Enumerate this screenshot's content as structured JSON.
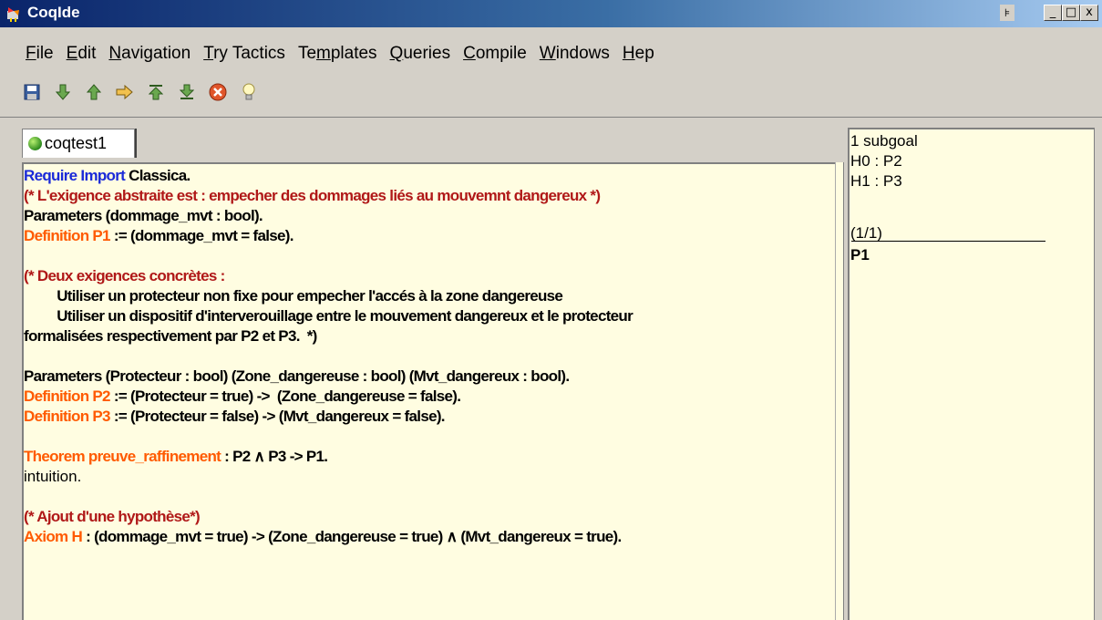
{
  "window": {
    "title": "CoqIde",
    "controls": {
      "pin": "⊧",
      "minimize": "_",
      "maximize": "□",
      "close": "x"
    }
  },
  "menu": [
    {
      "u": "F",
      "rest": "ile"
    },
    {
      "u": "E",
      "rest": "dit"
    },
    {
      "u": "N",
      "rest": "avigation"
    },
    {
      "u": "T",
      "rest": "ry Tactics"
    },
    {
      "pre": "Te",
      "u": "m",
      "rest": "plates"
    },
    {
      "u": "Q",
      "rest": "ueries"
    },
    {
      "u": "C",
      "rest": "ompile"
    },
    {
      "u": "W",
      "rest": "indows"
    },
    {
      "u": "H",
      "rest": "ep"
    }
  ],
  "toolbar": [
    "save-icon",
    "step-forward-icon",
    "step-back-icon",
    "go-to-cursor-icon",
    "go-to-start-icon",
    "go-to-end-icon",
    "interrupt-icon",
    "hint-icon"
  ],
  "tab": {
    "label": "coqtest1"
  },
  "code_lines": [
    [
      {
        "t": "Require Import ",
        "c": "kw-blue"
      },
      {
        "t": "Classica.",
        "c": ""
      }
    ],
    [
      {
        "t": "(* L'exigence abstraite est : empecher des dommages liés au mouvemnt dangereux *)",
        "c": "cmt"
      }
    ],
    [
      {
        "t": "Parameters (dommage_mvt : bool).",
        "c": ""
      }
    ],
    [
      {
        "t": "Definition P1",
        "c": "kw-orange"
      },
      {
        "t": " := (dommage_mvt = false).",
        "c": ""
      }
    ],
    [
      {
        "t": "",
        "c": ""
      }
    ],
    [
      {
        "t": "(* Deux exigences concrètes :",
        "c": "cmt"
      }
    ],
    [
      {
        "t": "         Utiliser un protecteur non fixe pour empecher l'accés à la zone dangereuse",
        "c": ""
      }
    ],
    [
      {
        "t": "         Utiliser un dispositif d'interverouillage entre le mouvement dangereux et le protecteur",
        "c": ""
      }
    ],
    [
      {
        "t": "formalisées respectivement par P2 et P3.  *)",
        "c": ""
      }
    ],
    [
      {
        "t": "",
        "c": ""
      }
    ],
    [
      {
        "t": "Parameters (Protecteur : bool) (Zone_dangereuse : bool) (Mvt_dangereux : bool).",
        "c": ""
      }
    ],
    [
      {
        "t": "Definition P2",
        "c": "kw-orange"
      },
      {
        "t": " := (Protecteur = true) ->  (Zone_dangereuse = false).",
        "c": ""
      }
    ],
    [
      {
        "t": "Definition P3",
        "c": "kw-orange"
      },
      {
        "t": " := (Protecteur = false) -> (Mvt_dangereux = false).",
        "c": ""
      }
    ],
    [
      {
        "t": "",
        "c": ""
      }
    ],
    [
      {
        "t": "Theorem preuve_raffinement",
        "c": "kw-orange"
      },
      {
        "t": " : P2 ∧ P3 -> P1.",
        "c": ""
      }
    ],
    [
      {
        "t": "intuition.",
        "c": "norm"
      }
    ],
    [
      {
        "t": "",
        "c": ""
      }
    ],
    [
      {
        "t": "(* Ajout d'une hypothèse*)",
        "c": "cmt"
      }
    ],
    [
      {
        "t": "Axiom H",
        "c": "kw-orange"
      },
      {
        "t": " : (dommage_mvt = true) -> (Zone_dangereuse = true) ∧ (Mvt_dangereux = true).",
        "c": ""
      }
    ]
  ],
  "goals": {
    "subgoals": "1 subgoal",
    "hyps": [
      "H0 : P2",
      "H1 : P3"
    ],
    "counter": "(1/1)",
    "conclusion": "P1"
  }
}
